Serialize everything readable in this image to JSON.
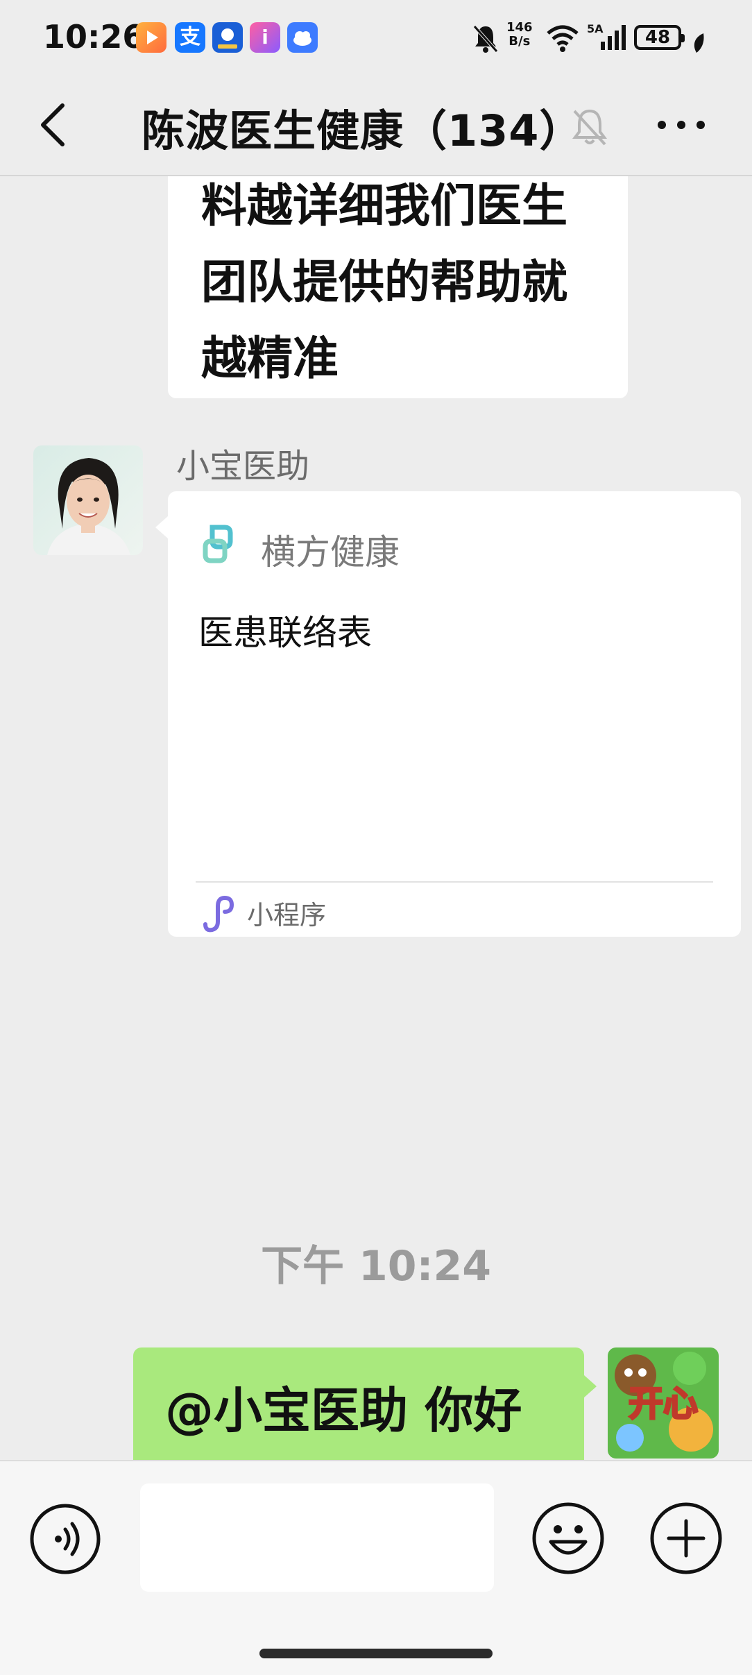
{
  "status_bar": {
    "time": "10:26",
    "net_speed_value": "146",
    "net_speed_unit": "B/s",
    "signal_label": "5A",
    "battery": "48",
    "icons": [
      "video-app-icon",
      "alipay-icon",
      "bank-app-icon",
      "itab-icon",
      "cloud-icon",
      "mute-bell-icon",
      "wifi-icon",
      "signal-icon",
      "battery-icon",
      "leaf-icon"
    ]
  },
  "nav": {
    "title": "陈波医生健康（134）",
    "icons": [
      "back-icon",
      "muted-bell-icon",
      "more-icon"
    ]
  },
  "messages": {
    "prev_text": "料越详细我们医生团队提供的帮助就越精准",
    "sender_name": "小宝医助",
    "mini_program": {
      "app_name": "横方健康",
      "title": "医患联络表",
      "footer_label": "小程序"
    },
    "timestamp": "下午 10:24",
    "my_text": "@小宝医助 你好 想问一下该",
    "my_avatar_text": "开心"
  },
  "input_bar": {
    "placeholder": "",
    "icons": [
      "voice-icon",
      "emoji-icon",
      "plus-icon"
    ]
  },
  "colors": {
    "background": "#ededed",
    "my_bubble": "#a9e97d",
    "card": "#ffffff"
  }
}
